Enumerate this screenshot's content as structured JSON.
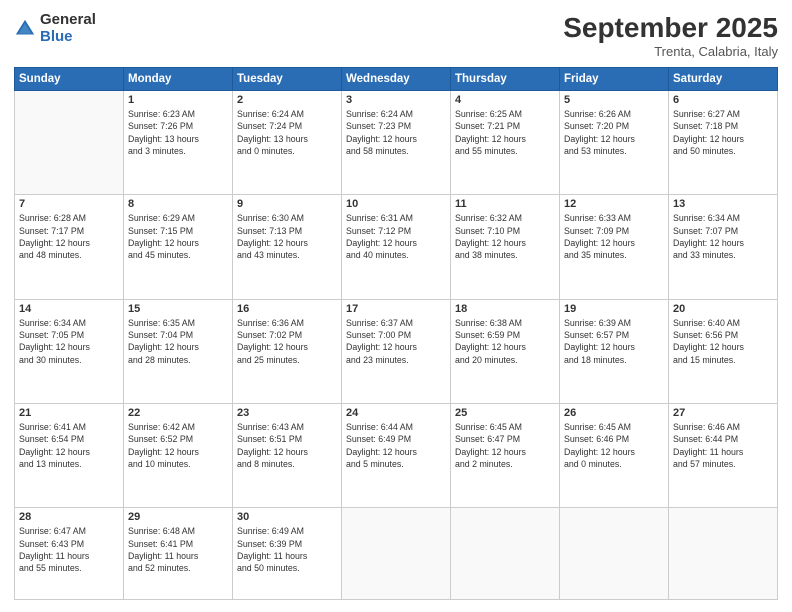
{
  "logo": {
    "general": "General",
    "blue": "Blue"
  },
  "header": {
    "month": "September 2025",
    "location": "Trenta, Calabria, Italy"
  },
  "days_of_week": [
    "Sunday",
    "Monday",
    "Tuesday",
    "Wednesday",
    "Thursday",
    "Friday",
    "Saturday"
  ],
  "weeks": [
    [
      {
        "day": "",
        "info": ""
      },
      {
        "day": "1",
        "info": "Sunrise: 6:23 AM\nSunset: 7:26 PM\nDaylight: 13 hours\nand 3 minutes."
      },
      {
        "day": "2",
        "info": "Sunrise: 6:24 AM\nSunset: 7:24 PM\nDaylight: 13 hours\nand 0 minutes."
      },
      {
        "day": "3",
        "info": "Sunrise: 6:24 AM\nSunset: 7:23 PM\nDaylight: 12 hours\nand 58 minutes."
      },
      {
        "day": "4",
        "info": "Sunrise: 6:25 AM\nSunset: 7:21 PM\nDaylight: 12 hours\nand 55 minutes."
      },
      {
        "day": "5",
        "info": "Sunrise: 6:26 AM\nSunset: 7:20 PM\nDaylight: 12 hours\nand 53 minutes."
      },
      {
        "day": "6",
        "info": "Sunrise: 6:27 AM\nSunset: 7:18 PM\nDaylight: 12 hours\nand 50 minutes."
      }
    ],
    [
      {
        "day": "7",
        "info": "Sunrise: 6:28 AM\nSunset: 7:17 PM\nDaylight: 12 hours\nand 48 minutes."
      },
      {
        "day": "8",
        "info": "Sunrise: 6:29 AM\nSunset: 7:15 PM\nDaylight: 12 hours\nand 45 minutes."
      },
      {
        "day": "9",
        "info": "Sunrise: 6:30 AM\nSunset: 7:13 PM\nDaylight: 12 hours\nand 43 minutes."
      },
      {
        "day": "10",
        "info": "Sunrise: 6:31 AM\nSunset: 7:12 PM\nDaylight: 12 hours\nand 40 minutes."
      },
      {
        "day": "11",
        "info": "Sunrise: 6:32 AM\nSunset: 7:10 PM\nDaylight: 12 hours\nand 38 minutes."
      },
      {
        "day": "12",
        "info": "Sunrise: 6:33 AM\nSunset: 7:09 PM\nDaylight: 12 hours\nand 35 minutes."
      },
      {
        "day": "13",
        "info": "Sunrise: 6:34 AM\nSunset: 7:07 PM\nDaylight: 12 hours\nand 33 minutes."
      }
    ],
    [
      {
        "day": "14",
        "info": "Sunrise: 6:34 AM\nSunset: 7:05 PM\nDaylight: 12 hours\nand 30 minutes."
      },
      {
        "day": "15",
        "info": "Sunrise: 6:35 AM\nSunset: 7:04 PM\nDaylight: 12 hours\nand 28 minutes."
      },
      {
        "day": "16",
        "info": "Sunrise: 6:36 AM\nSunset: 7:02 PM\nDaylight: 12 hours\nand 25 minutes."
      },
      {
        "day": "17",
        "info": "Sunrise: 6:37 AM\nSunset: 7:00 PM\nDaylight: 12 hours\nand 23 minutes."
      },
      {
        "day": "18",
        "info": "Sunrise: 6:38 AM\nSunset: 6:59 PM\nDaylight: 12 hours\nand 20 minutes."
      },
      {
        "day": "19",
        "info": "Sunrise: 6:39 AM\nSunset: 6:57 PM\nDaylight: 12 hours\nand 18 minutes."
      },
      {
        "day": "20",
        "info": "Sunrise: 6:40 AM\nSunset: 6:56 PM\nDaylight: 12 hours\nand 15 minutes."
      }
    ],
    [
      {
        "day": "21",
        "info": "Sunrise: 6:41 AM\nSunset: 6:54 PM\nDaylight: 12 hours\nand 13 minutes."
      },
      {
        "day": "22",
        "info": "Sunrise: 6:42 AM\nSunset: 6:52 PM\nDaylight: 12 hours\nand 10 minutes."
      },
      {
        "day": "23",
        "info": "Sunrise: 6:43 AM\nSunset: 6:51 PM\nDaylight: 12 hours\nand 8 minutes."
      },
      {
        "day": "24",
        "info": "Sunrise: 6:44 AM\nSunset: 6:49 PM\nDaylight: 12 hours\nand 5 minutes."
      },
      {
        "day": "25",
        "info": "Sunrise: 6:45 AM\nSunset: 6:47 PM\nDaylight: 12 hours\nand 2 minutes."
      },
      {
        "day": "26",
        "info": "Sunrise: 6:45 AM\nSunset: 6:46 PM\nDaylight: 12 hours\nand 0 minutes."
      },
      {
        "day": "27",
        "info": "Sunrise: 6:46 AM\nSunset: 6:44 PM\nDaylight: 11 hours\nand 57 minutes."
      }
    ],
    [
      {
        "day": "28",
        "info": "Sunrise: 6:47 AM\nSunset: 6:43 PM\nDaylight: 11 hours\nand 55 minutes."
      },
      {
        "day": "29",
        "info": "Sunrise: 6:48 AM\nSunset: 6:41 PM\nDaylight: 11 hours\nand 52 minutes."
      },
      {
        "day": "30",
        "info": "Sunrise: 6:49 AM\nSunset: 6:39 PM\nDaylight: 11 hours\nand 50 minutes."
      },
      {
        "day": "",
        "info": ""
      },
      {
        "day": "",
        "info": ""
      },
      {
        "day": "",
        "info": ""
      },
      {
        "day": "",
        "info": ""
      }
    ]
  ]
}
